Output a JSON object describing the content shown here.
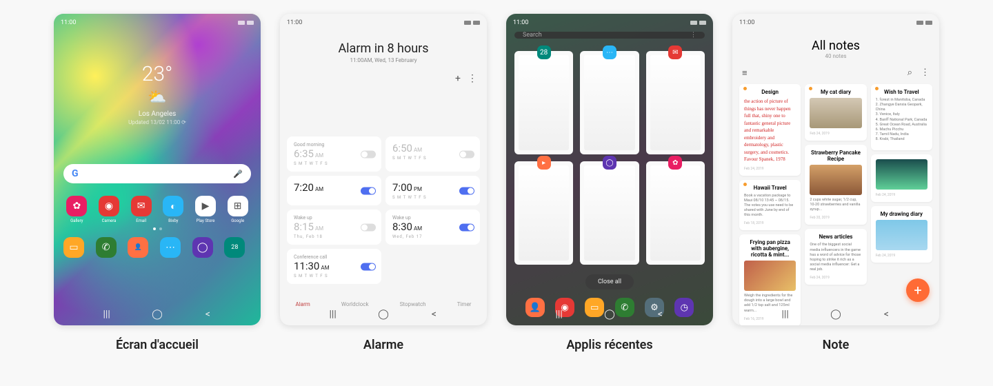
{
  "captions": [
    "Écran d'accueil",
    "Alarme",
    "Applis récentes",
    "Note"
  ],
  "time": "11:00",
  "home": {
    "temp": "23°",
    "city": "Los Angeles",
    "updated": "Updated 13/02 11:00 ⟳",
    "search_icon": "G",
    "apps": [
      {
        "label": "Gallery",
        "color": "#e91e63",
        "glyph": "✿"
      },
      {
        "label": "Camera",
        "color": "#e53935",
        "glyph": "◉"
      },
      {
        "label": "Email",
        "color": "#e53935",
        "glyph": "✉"
      },
      {
        "label": "Bixby",
        "color": "#29b6f6",
        "glyph": "◐"
      },
      {
        "label": "Play Store",
        "color": "#fff",
        "glyph": "▶"
      },
      {
        "label": "Google",
        "color": "#fff",
        "glyph": "⊞"
      }
    ],
    "dock": [
      {
        "color": "#ffa726",
        "glyph": "▭",
        "name": "files"
      },
      {
        "color": "#2e7d32",
        "glyph": "✆",
        "name": "phone"
      },
      {
        "color": "#ff7043",
        "glyph": "👤",
        "name": "contacts"
      },
      {
        "color": "#29b6f6",
        "glyph": "⋯",
        "name": "messages"
      },
      {
        "color": "#5e35b1",
        "glyph": "◯",
        "name": "internet"
      },
      {
        "color": "#00897b",
        "glyph": "28",
        "name": "calendar"
      }
    ]
  },
  "alarm": {
    "title": "Alarm in 8 hours",
    "subtitle": "11:00AM, Wed, 13 February",
    "tabs": [
      "Alarm",
      "Worldclock",
      "Stopwatch",
      "Timer"
    ],
    "list": [
      {
        "name": "Good morning",
        "time": "6:35",
        "ampm": "AM",
        "days": "S M T W T F S",
        "on": false
      },
      {
        "name": "",
        "time": "6:50",
        "ampm": "AM",
        "days": "S M T W T F S",
        "on": false
      },
      {
        "name": "",
        "time": "7:20",
        "ampm": "AM",
        "days": "",
        "on": true
      },
      {
        "name": "",
        "time": "7:00",
        "ampm": "PM",
        "days": "S M T W T F S",
        "on": true
      },
      {
        "name": "Wake up",
        "time": "8:15",
        "ampm": "AM",
        "days": "Thu, Feb 18",
        "on": false
      },
      {
        "name": "Wake up",
        "time": "8:30",
        "ampm": "AM",
        "days": "Wed, Feb 17",
        "on": true
      },
      {
        "name": "Conference call",
        "time": "11:30",
        "ampm": "AM",
        "days": "S M T W T F S",
        "on": true
      }
    ]
  },
  "recents": {
    "search": "Search",
    "closeall": "Close all",
    "cards": [
      {
        "color": "#00897b",
        "glyph": "28",
        "name": "calendar"
      },
      {
        "color": "#29b6f6",
        "glyph": "⋯",
        "name": "messages"
      },
      {
        "color": "#e53935",
        "glyph": "✉",
        "name": "email"
      },
      {
        "color": "#ff7043",
        "glyph": "▸",
        "name": "music"
      },
      {
        "color": "#5e35b1",
        "glyph": "◯",
        "name": "internet"
      },
      {
        "color": "#e91e63",
        "glyph": "✿",
        "name": "gallery"
      }
    ],
    "dock": [
      {
        "color": "#ff7043",
        "glyph": "👤",
        "name": "contacts"
      },
      {
        "color": "#e53935",
        "glyph": "◉",
        "name": "camera"
      },
      {
        "color": "#ffa726",
        "glyph": "▭",
        "name": "files"
      },
      {
        "color": "#2e7d32",
        "glyph": "✆",
        "name": "phone"
      },
      {
        "color": "#546e7a",
        "glyph": "⚙",
        "name": "settings"
      },
      {
        "color": "#5e35b1",
        "glyph": "◷",
        "name": "clock"
      }
    ]
  },
  "notes": {
    "title": "All notes",
    "count": "40 notes",
    "col1": [
      {
        "title": "Design",
        "body": "the action of picture of things has never happen full that, shiny one to fantastic general picture and remarkable embroidery and dermatology, plastic surgery, and cosmetics. Favour Spanek, 1978",
        "date": "Feb 24, 2019",
        "hw": true,
        "pin": true
      },
      {
        "title": "Hawaii Travel",
        "body": "Book a vacation package to Maui 08/10 13:45 ~ 08/15. The votes you use need to be shared with June by end of this month.",
        "date": "Feb 18, 2019",
        "pin": true
      },
      {
        "title": "Frying pan pizza with aubergine, ricotta & mint...",
        "body": "Weigh the ingredients for the dough into a large bowl and add 1/2 tsp salt and 125ml warm...",
        "date": "Feb 16, 2019",
        "img": "linear-gradient(135deg,#c0604a,#e8c068)"
      }
    ],
    "col2": [
      {
        "title": "My cat diary",
        "date": "Feb 24, 2019",
        "img": "linear-gradient(180deg,#d4c8b4,#a89878)",
        "pin": true
      },
      {
        "title": "Strawberry Pancake Recipe",
        "body": "2 cups white sugar, 1/2 cup, 10-20 strawberries and vanilla syrup...",
        "date": "Feb 20, 2019",
        "img": "linear-gradient(180deg,#d4a068,#8b5838)"
      },
      {
        "title": "News articles",
        "body": "One of the biggest social media influencers in the game has a word of advice for those hoping to strike it rich as a social media influencer: Get a real job.",
        "date": "Feb 24, 2019"
      }
    ],
    "col3": [
      {
        "title": "Wish to Travel",
        "body": "1. forest in Manitoba, Canada\n2. Zhangye Danxia Geopark, China\n3. Venice, Italy\n4. Banff National Park, Canada\n5. Great Ocean Road, Australia\n6. Machu Picchu\n7. Tamil Nadu, India\n8. Krabi, Thailand",
        "date": "",
        "pin": true
      },
      {
        "title": "",
        "date": "Feb 24, 2019",
        "img": "linear-gradient(180deg,#1a4d4d,#5fd098)"
      },
      {
        "title": "My drawing diary",
        "date": "Feb 24, 2019",
        "img": "linear-gradient(180deg,#7fc8e8,#a8d8f0)"
      }
    ]
  }
}
